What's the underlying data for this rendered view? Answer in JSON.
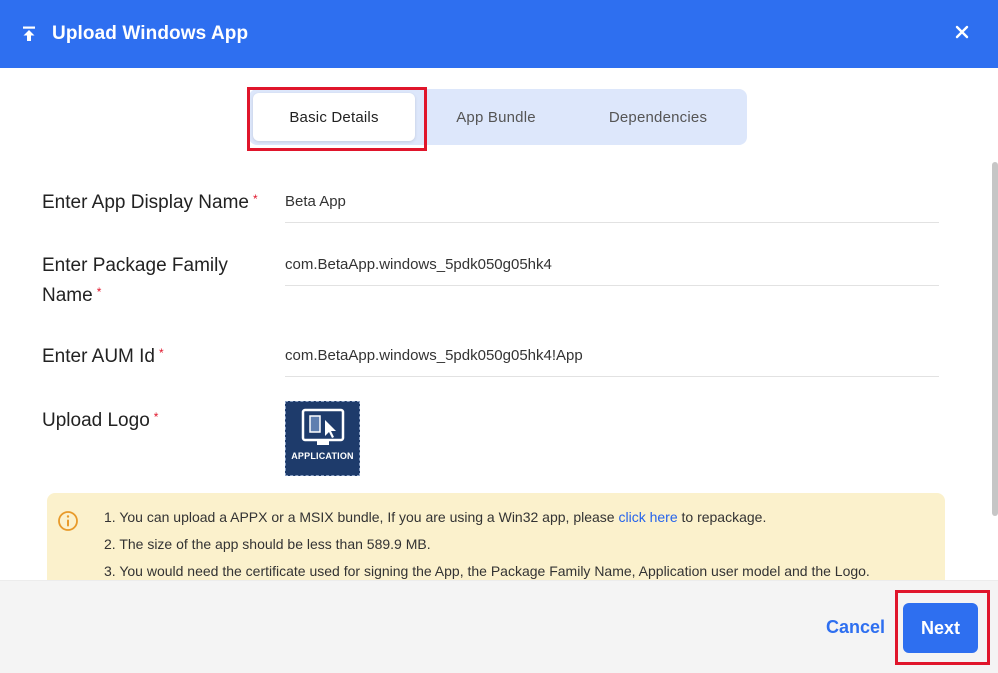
{
  "header": {
    "title": "Upload Windows App",
    "upload_icon": "upload-icon",
    "close_icon": "close-icon"
  },
  "tabs": [
    {
      "label": "Basic Details",
      "active": true
    },
    {
      "label": "App Bundle",
      "active": false
    },
    {
      "label": "Dependencies",
      "active": false
    }
  ],
  "form": {
    "display_name": {
      "label": "Enter App Display Name",
      "value": "Beta App"
    },
    "package_family": {
      "label_line1": "Enter Package Family",
      "label_line2": "Name",
      "value": "com.BetaApp.windows_5pdk050g05hk4"
    },
    "aum_id": {
      "label": "Enter AUM Id",
      "value": "com.BetaApp.windows_5pdk050g05hk4!App"
    },
    "logo": {
      "label": "Upload Logo",
      "caption": "APPLICATION"
    },
    "required_mark": "*"
  },
  "info": {
    "icon": "info-icon",
    "line1_prefix": "1. You can upload a APPX or a MSIX bundle, If you are using a Win32 app, please ",
    "line1_link": "click here",
    "line1_suffix": " to repackage.",
    "line2": "2. The size of the app should be less than 589.9 MB.",
    "line3": "3. You would need the certificate used for signing the App, the Package Family Name, Application user model and the Logo."
  },
  "footer": {
    "cancel_label": "Cancel",
    "next_label": "Next"
  },
  "colors": {
    "accent": "#2e6ff0",
    "highlight": "#e0152b",
    "info_bg": "#fbf1cc"
  }
}
